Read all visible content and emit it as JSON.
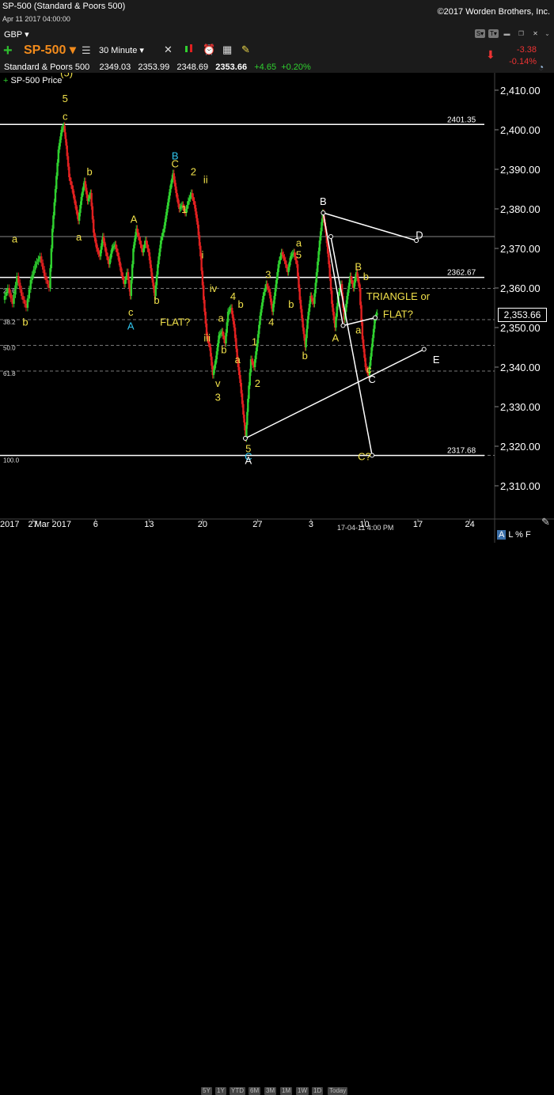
{
  "header": {
    "title": "SP-500 (Standard & Poors 500)",
    "date": "Apr 11 2017 04:00:00",
    "copyright": "©2017 Worden Brothers, Inc.",
    "currency": "GBP ▾",
    "symbol": "SP-500 ▾",
    "interval": "30 Minute ▾",
    "name": "Standard & Poors 500",
    "open": "2349.03",
    "high": "2353.99",
    "low": "2348.69",
    "last": "2353.66",
    "change": "+4.65",
    "change_pct": "+0.20%",
    "right_change": "-3.38",
    "right_change_pct": "-0.14%",
    "legend": "SP-500 Price",
    "price_box": "2,353.66",
    "timestamp": "17-04-11 4:00 PM",
    "alf": "L % F",
    "alf_a": "A"
  },
  "ranges": [
    "5Y",
    "1Y",
    "YTD",
    "6M",
    "3M",
    "1M",
    "1W",
    "1D",
    "Today"
  ],
  "icons": {
    "add": "plus-icon",
    "menu": "menu-icon",
    "tools": "wrench-icon",
    "candles": "candlestick-icon",
    "alarm": "alarm-icon",
    "calendar": "calendar-icon",
    "note": "note-icon"
  },
  "colors": {
    "up": "#2fd02f",
    "down": "#e02020",
    "wave": "#f0e04a",
    "cyan": "#31c6ee",
    "line": "#ffffff",
    "grid": "#555555",
    "bg": "#000000"
  },
  "chart_data": {
    "type": "candlestick",
    "title": "SP-500 Price",
    "ylim": [
      2305,
      2414
    ],
    "y_ticks": [
      "2,310.00",
      "2,320.00",
      "2,330.00",
      "2,340.00",
      "2,350.00",
      "2,360.00",
      "2,370.00",
      "2,380.00",
      "2,390.00",
      "2,400.00",
      "2,410.00"
    ],
    "y_tick_values": [
      2310,
      2320,
      2330,
      2340,
      2350,
      2360,
      2370,
      2380,
      2390,
      2400,
      2410
    ],
    "x_labels": [
      "2017",
      "27",
      "Mar 2017",
      "6",
      "13",
      "20",
      "27",
      "3",
      "10",
      "17",
      "24"
    ],
    "x_label_positions": [
      0,
      1.9,
      3.2,
      6.0,
      9.5,
      13.0,
      16.6,
      20.1,
      23.6,
      27.1,
      30.5
    ],
    "x_range": [
      0,
      33
    ],
    "horizontal_levels": [
      {
        "label": "2401.35",
        "value": 2401.35
      },
      {
        "label": "2362.67",
        "value": 2362.67
      },
      {
        "label": "2317.68",
        "value": 2317.68
      }
    ],
    "fib_levels": [
      {
        "label": "23.6",
        "value": 2359.9
      },
      {
        "label": "38.2",
        "value": 2352.0
      },
      {
        "label": "50.0",
        "value": 2345.5
      },
      {
        "label": "61.8",
        "value": 2339.0
      },
      {
        "label": "100.0",
        "value": 2317.7
      }
    ],
    "extra_level": 2373.0,
    "triangle": {
      "B": [
        20.9,
        2379.0
      ],
      "D": [
        27.0,
        2372.0
      ],
      "A_start": [
        15.8,
        2322.0
      ],
      "E": [
        27.5,
        2344.5
      ],
      "C_top": [
        21.4,
        2373.0
      ],
      "C_bottom": [
        24.1,
        2317.7
      ],
      "p1": [
        22.2,
        2350.5
      ],
      "p2": [
        24.3,
        2352.5
      ]
    },
    "annotations": [
      {
        "text": "(5)",
        "x": 4.1,
        "y": 2413.5,
        "color": "wave"
      },
      {
        "text": "5",
        "x": 4.0,
        "y": 2407.0,
        "color": "wave"
      },
      {
        "text": "c",
        "x": 4.0,
        "y": 2402.5,
        "color": "wave"
      },
      {
        "text": "b",
        "x": 5.6,
        "y": 2388.5,
        "color": "wave"
      },
      {
        "text": "a",
        "x": 0.7,
        "y": 2371.5,
        "color": "wave"
      },
      {
        "text": "a",
        "x": 4.9,
        "y": 2372.0,
        "color": "wave"
      },
      {
        "text": "b",
        "x": 1.4,
        "y": 2350.5,
        "color": "wave"
      },
      {
        "text": "A",
        "x": 8.5,
        "y": 2376.5,
        "color": "wave"
      },
      {
        "text": "c",
        "x": 8.3,
        "y": 2353.0,
        "color": "wave"
      },
      {
        "text": "A",
        "x": 8.3,
        "y": 2349.5,
        "color": "cyan"
      },
      {
        "text": "b",
        "x": 10.0,
        "y": 2356.0,
        "color": "wave"
      },
      {
        "text": "B",
        "x": 11.2,
        "y": 2392.5,
        "color": "cyan"
      },
      {
        "text": "C",
        "x": 11.2,
        "y": 2390.5,
        "color": "wave"
      },
      {
        "text": "2",
        "x": 12.4,
        "y": 2388.5,
        "color": "wave"
      },
      {
        "text": "ii",
        "x": 13.2,
        "y": 2386.5,
        "color": "wave"
      },
      {
        "text": "1",
        "x": 11.8,
        "y": 2379.0,
        "color": "wave"
      },
      {
        "text": "i",
        "x": 13.0,
        "y": 2367.5,
        "color": "wave"
      },
      {
        "text": "iv",
        "x": 13.7,
        "y": 2359.0,
        "color": "wave"
      },
      {
        "text": "FLAT?",
        "x": 11.2,
        "y": 2350.5,
        "color": "wave"
      },
      {
        "text": "4",
        "x": 15.0,
        "y": 2357.0,
        "color": "wave"
      },
      {
        "text": "b",
        "x": 15.5,
        "y": 2355.0,
        "color": "wave"
      },
      {
        "text": "a",
        "x": 14.2,
        "y": 2351.5,
        "color": "wave"
      },
      {
        "text": "iii",
        "x": 13.3,
        "y": 2346.5,
        "color": "wave"
      },
      {
        "text": "b",
        "x": 14.4,
        "y": 2343.5,
        "color": "wave"
      },
      {
        "text": "a",
        "x": 15.3,
        "y": 2341.0,
        "color": "wave"
      },
      {
        "text": "v",
        "x": 14.0,
        "y": 2335.0,
        "color": "wave"
      },
      {
        "text": "3",
        "x": 14.0,
        "y": 2331.5,
        "color": "wave"
      },
      {
        "text": "3",
        "x": 17.3,
        "y": 2362.5,
        "color": "wave"
      },
      {
        "text": "4",
        "x": 17.5,
        "y": 2350.5,
        "color": "wave"
      },
      {
        "text": "1",
        "x": 16.4,
        "y": 2345.5,
        "color": "wave"
      },
      {
        "text": "2",
        "x": 16.6,
        "y": 2335.0,
        "color": "wave"
      },
      {
        "text": "5",
        "x": 16.0,
        "y": 2318.5,
        "color": "wave"
      },
      {
        "text": "C",
        "x": 16.0,
        "y": 2316.5,
        "color": "cyan"
      },
      {
        "text": "A",
        "x": 16.0,
        "y": 2315.5,
        "color": "line"
      },
      {
        "text": "a",
        "x": 19.3,
        "y": 2370.5,
        "color": "wave"
      },
      {
        "text": "5",
        "x": 19.3,
        "y": 2367.5,
        "color": "wave"
      },
      {
        "text": "b",
        "x": 18.8,
        "y": 2355.0,
        "color": "wave"
      },
      {
        "text": "b",
        "x": 19.7,
        "y": 2342.0,
        "color": "wave"
      },
      {
        "text": "B",
        "x": 20.9,
        "y": 2381.0,
        "color": "line"
      },
      {
        "text": "A",
        "x": 21.7,
        "y": 2346.5,
        "color": "wave"
      },
      {
        "text": "B",
        "x": 23.2,
        "y": 2364.5,
        "color": "wave"
      },
      {
        "text": "b",
        "x": 23.7,
        "y": 2362.0,
        "color": "wave"
      },
      {
        "text": "a",
        "x": 23.2,
        "y": 2348.5,
        "color": "wave"
      },
      {
        "text": "c",
        "x": 23.9,
        "y": 2338.5,
        "color": "wave"
      },
      {
        "text": "C",
        "x": 24.1,
        "y": 2336.0,
        "color": "line"
      },
      {
        "text": "C?",
        "x": 23.6,
        "y": 2316.5,
        "color": "wave"
      },
      {
        "text": "D",
        "x": 27.2,
        "y": 2372.5,
        "color": "line"
      },
      {
        "text": "E",
        "x": 28.3,
        "y": 2341.0,
        "color": "line"
      },
      {
        "text": "TRIANGLE or",
        "x": 25.8,
        "y": 2357.0,
        "color": "wave"
      },
      {
        "text": "FLAT?",
        "x": 25.8,
        "y": 2352.5,
        "color": "wave"
      }
    ],
    "price_path": [
      [
        0.0,
        2357
      ],
      [
        0.3,
        2360
      ],
      [
        0.6,
        2356
      ],
      [
        0.9,
        2363
      ],
      [
        1.2,
        2358
      ],
      [
        1.5,
        2355
      ],
      [
        1.8,
        2362
      ],
      [
        2.1,
        2366
      ],
      [
        2.4,
        2368
      ],
      [
        2.7,
        2363
      ],
      [
        3.0,
        2360
      ],
      [
        3.2,
        2375
      ],
      [
        3.4,
        2385
      ],
      [
        3.6,
        2395
      ],
      [
        3.8,
        2400
      ],
      [
        3.95,
        2401
      ],
      [
        4.1,
        2396
      ],
      [
        4.3,
        2388
      ],
      [
        4.5,
        2385
      ],
      [
        4.7,
        2381
      ],
      [
        4.9,
        2377
      ],
      [
        5.1,
        2383
      ],
      [
        5.3,
        2387
      ],
      [
        5.5,
        2382
      ],
      [
        5.7,
        2384
      ],
      [
        5.9,
        2374
      ],
      [
        6.1,
        2370
      ],
      [
        6.3,
        2368
      ],
      [
        6.5,
        2373
      ],
      [
        6.7,
        2369
      ],
      [
        6.9,
        2366
      ],
      [
        7.1,
        2370
      ],
      [
        7.3,
        2371
      ],
      [
        7.5,
        2368
      ],
      [
        7.7,
        2364
      ],
      [
        7.9,
        2361
      ],
      [
        8.1,
        2364
      ],
      [
        8.3,
        2358
      ],
      [
        8.5,
        2370
      ],
      [
        8.7,
        2375
      ],
      [
        8.9,
        2372
      ],
      [
        9.1,
        2369
      ],
      [
        9.3,
        2372
      ],
      [
        9.5,
        2369
      ],
      [
        9.7,
        2363
      ],
      [
        9.9,
        2358
      ],
      [
        10.1,
        2366
      ],
      [
        10.3,
        2372
      ],
      [
        10.5,
        2375
      ],
      [
        10.7,
        2380
      ],
      [
        10.9,
        2385
      ],
      [
        11.1,
        2389
      ],
      [
        11.3,
        2384
      ],
      [
        11.5,
        2380
      ],
      [
        11.7,
        2381
      ],
      [
        11.9,
        2379
      ],
      [
        12.1,
        2382
      ],
      [
        12.3,
        2384
      ],
      [
        12.5,
        2381
      ],
      [
        12.7,
        2376
      ],
      [
        12.9,
        2368
      ],
      [
        13.1,
        2357
      ],
      [
        13.3,
        2348
      ],
      [
        13.5,
        2345
      ],
      [
        13.7,
        2338
      ],
      [
        13.9,
        2342
      ],
      [
        14.1,
        2348
      ],
      [
        14.3,
        2349
      ],
      [
        14.5,
        2346
      ],
      [
        14.7,
        2354
      ],
      [
        14.9,
        2355
      ],
      [
        15.1,
        2350
      ],
      [
        15.3,
        2342
      ],
      [
        15.5,
        2336
      ],
      [
        15.7,
        2328
      ],
      [
        15.85,
        2322
      ],
      [
        16.0,
        2332
      ],
      [
        16.2,
        2342
      ],
      [
        16.4,
        2340
      ],
      [
        16.6,
        2346
      ],
      [
        16.8,
        2353
      ],
      [
        17.0,
        2358
      ],
      [
        17.2,
        2361
      ],
      [
        17.4,
        2359
      ],
      [
        17.6,
        2354
      ],
      [
        17.8,
        2360
      ],
      [
        18.0,
        2366
      ],
      [
        18.2,
        2369
      ],
      [
        18.4,
        2367
      ],
      [
        18.6,
        2364
      ],
      [
        18.8,
        2368
      ],
      [
        19.0,
        2369
      ],
      [
        19.2,
        2366
      ],
      [
        19.4,
        2357
      ],
      [
        19.6,
        2350
      ],
      [
        19.75,
        2345
      ],
      [
        19.9,
        2352
      ],
      [
        20.1,
        2358
      ],
      [
        20.3,
        2356
      ],
      [
        20.5,
        2364
      ],
      [
        20.7,
        2372
      ],
      [
        20.9,
        2379
      ],
      [
        21.1,
        2374
      ],
      [
        21.3,
        2366
      ],
      [
        21.5,
        2356
      ],
      [
        21.7,
        2350
      ],
      [
        21.9,
        2358
      ],
      [
        22.1,
        2361
      ],
      [
        22.3,
        2352
      ],
      [
        22.5,
        2358
      ],
      [
        22.7,
        2363
      ],
      [
        22.9,
        2360
      ],
      [
        23.1,
        2364
      ],
      [
        23.3,
        2360
      ],
      [
        23.5,
        2347
      ],
      [
        23.7,
        2340
      ],
      [
        23.9,
        2338
      ],
      [
        24.1,
        2345
      ],
      [
        24.3,
        2352
      ],
      [
        24.45,
        2353.7
      ]
    ]
  }
}
